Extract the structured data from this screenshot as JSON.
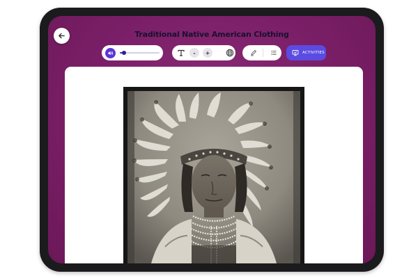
{
  "header": {
    "title": "Traditional Native American Clothing"
  },
  "audio": {
    "volume_fraction": 0.1
  },
  "font_controls": {
    "decrease_label": "-",
    "increase_label": "+"
  },
  "toolbar": {
    "activities_label": "ACTIVITIES"
  },
  "icons": {
    "back": "arrow-left-icon",
    "volume": "speaker-icon",
    "font": "text-size-icon",
    "language": "globe-icon",
    "highlight": "pen-icon",
    "list": "list-icon",
    "activities": "monitor-icon"
  },
  "colors": {
    "background": "#7a1f67",
    "accent": "#5b4be2",
    "title_text": "#1a1030"
  }
}
